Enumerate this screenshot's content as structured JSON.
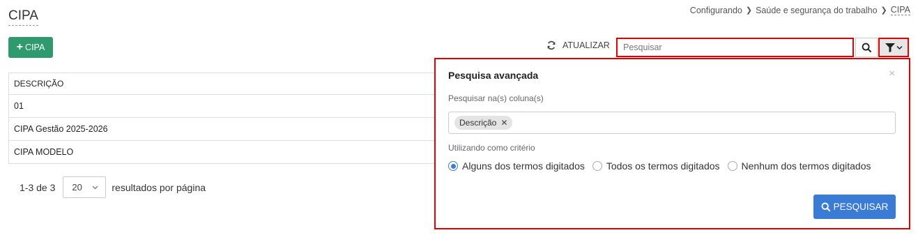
{
  "page": {
    "title": "CIPA"
  },
  "breadcrumb": {
    "items": [
      "Configurando",
      "Saúde e segurança do trabalho",
      "CIPA"
    ]
  },
  "toolbar": {
    "add_label": "CIPA",
    "refresh_label": "ATUALIZAR",
    "search_placeholder": "Pesquisar"
  },
  "table": {
    "header": "DESCRIÇÃO",
    "rows": [
      "01",
      "CIPA Gestão 2025-2026",
      "CIPA MODELO"
    ]
  },
  "pagination": {
    "range": "1-3 de 3",
    "page_size": "20",
    "suffix": "resultados por página"
  },
  "advanced_search": {
    "title": "Pesquisa avançada",
    "close": "×",
    "columns_label": "Pesquisar na(s) coluna(s)",
    "chips": [
      "Descrição"
    ],
    "criteria_label": "Utilizando como critério",
    "options": [
      "Alguns dos termos digitados",
      "Todos os termos digitados",
      "Nenhum dos termos digitados"
    ],
    "selected_option": 0,
    "submit_label": "PESQUISAR"
  },
  "colors": {
    "primary": "#3a7bd5",
    "success": "#2f9a6e",
    "highlight": "#e00000"
  }
}
